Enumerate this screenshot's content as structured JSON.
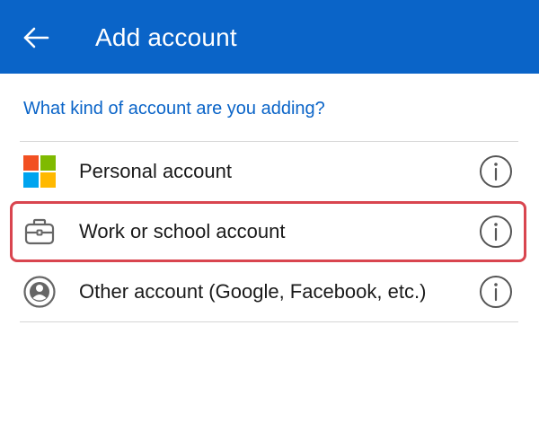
{
  "header": {
    "title": "Add account",
    "back_icon": "back-arrow-icon",
    "background_color": "#0a64c8"
  },
  "prompt": "What kind of account are you adding?",
  "account_options": [
    {
      "label": "Personal account",
      "icon": "microsoft-logo-icon",
      "info_icon": "info-icon"
    },
    {
      "label": "Work or school account",
      "icon": "briefcase-icon",
      "info_icon": "info-icon",
      "highlighted": true
    },
    {
      "label": "Other account (Google, Facebook, etc.)",
      "icon": "person-circle-icon",
      "info_icon": "info-icon"
    }
  ],
  "colors": {
    "accent": "#0a64c8",
    "highlight_border": "#d9454f",
    "ms_red": "#f25022",
    "ms_green": "#7fba00",
    "ms_blue": "#00a4ef",
    "ms_yellow": "#ffb900"
  }
}
